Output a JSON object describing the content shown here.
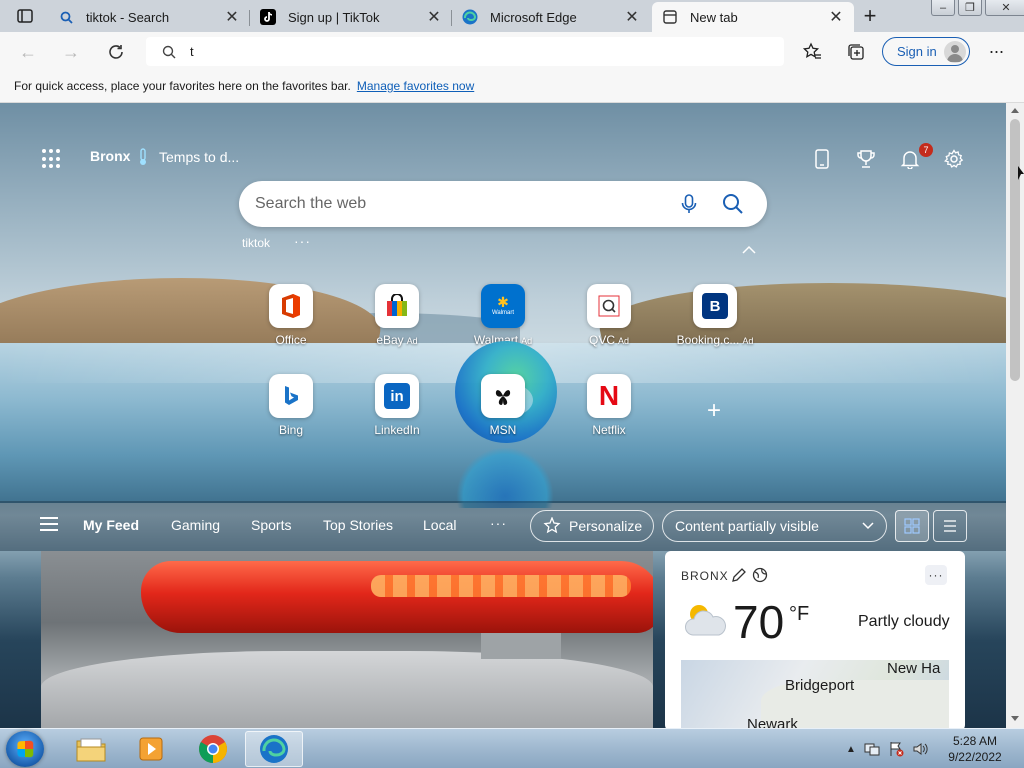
{
  "browser": {
    "tabs": [
      {
        "title": "tiktok - Search",
        "icon": "search-icon"
      },
      {
        "title": "Sign up | TikTok",
        "icon": "tiktok-icon"
      },
      {
        "title": "Microsoft Edge",
        "icon": "edge-icon"
      },
      {
        "title": "New tab",
        "icon": "newtab-icon",
        "active": true
      }
    ],
    "address_value": "t",
    "signin_label": "Sign in",
    "favorites_message": "For quick access, place your favorites here on the favorites bar.",
    "favorites_link": "Manage favorites now"
  },
  "newtab": {
    "location": "Bronx",
    "temp_label": "Temps to d...",
    "notification_count": "7",
    "search_placeholder": "Search the web",
    "recent_search": "tiktok",
    "tiles": [
      {
        "label": "Office",
        "ad": ""
      },
      {
        "label": "eBay",
        "ad": "Ad"
      },
      {
        "label": "Walmart",
        "ad": "Ad"
      },
      {
        "label": "QVC",
        "ad": "Ad"
      },
      {
        "label": "Booking.c...",
        "ad": "Ad"
      },
      {
        "label": "Bing",
        "ad": ""
      },
      {
        "label": "LinkedIn",
        "ad": ""
      },
      {
        "label": "MSN",
        "ad": ""
      },
      {
        "label": "Netflix",
        "ad": ""
      }
    ],
    "tile_icon_text": {
      "walmart": "Walmart",
      "booking": "B",
      "linkedin": "in",
      "netflix": "N"
    },
    "feed_tabs": [
      "My Feed",
      "Gaming",
      "Sports",
      "Top Stories",
      "Local"
    ],
    "personalize_label": "Personalize",
    "content_visibility": "Content partially visible"
  },
  "weather": {
    "city": "BRONX",
    "temperature": "70",
    "unit": "°F",
    "condition": "Partly cloudy",
    "map_labels": [
      "New Ha",
      "Bridgeport",
      "Newark"
    ]
  },
  "taskbar": {
    "time": "5:28 AM",
    "date": "9/22/2022"
  },
  "colors": {
    "accent": "#1a5fb4",
    "badge": "#c42b1c",
    "netflix": "#e50914",
    "office": "#d83b01",
    "linkedin": "#0a66c2",
    "booking": "#003580",
    "walmart": "#0071ce"
  }
}
